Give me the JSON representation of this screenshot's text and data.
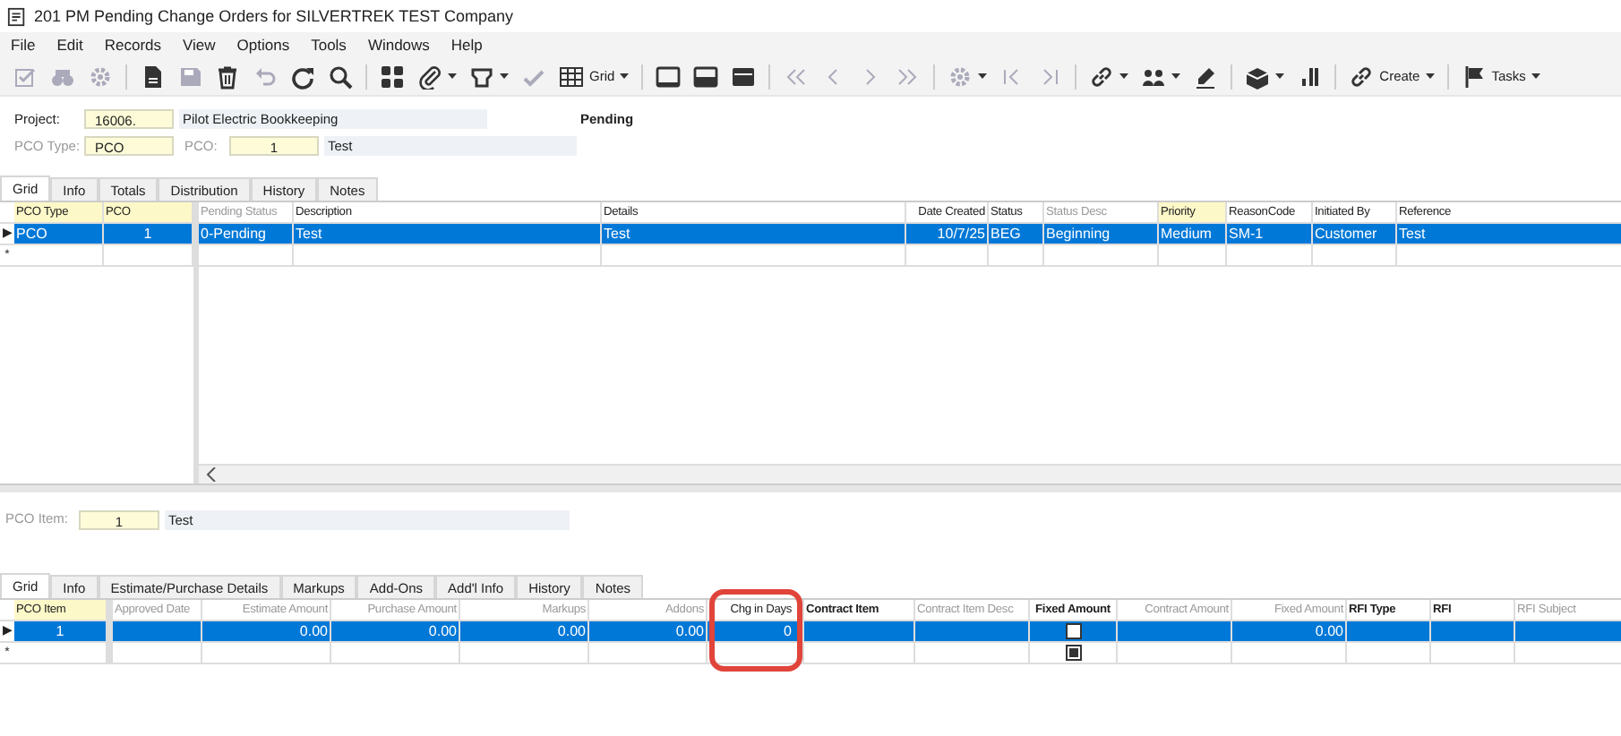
{
  "window": {
    "title": "201 PM Pending Change Orders for SILVERTREK TEST Company"
  },
  "menu": [
    "File",
    "Edit",
    "Records",
    "View",
    "Options",
    "Tools",
    "Windows",
    "Help"
  ],
  "toolbar": [
    {
      "disabled": true,
      "dropdown": false
    },
    {
      "disabled": true,
      "dropdown": false
    },
    {
      "disabled": true,
      "dropdown": false
    },
    {
      "disabled": false,
      "dropdown": false
    },
    {
      "disabled": true,
      "dropdown": false
    },
    {
      "disabled": false,
      "dropdown": false
    },
    {
      "disabled": true,
      "dropdown": false
    },
    {
      "disabled": false,
      "dropdown": false
    },
    {
      "disabled": false,
      "dropdown": false
    },
    {
      "disabled": false,
      "dropdown": false
    },
    {
      "disabled": false,
      "dropdown": true
    },
    {
      "disabled": false,
      "dropdown": true
    },
    {
      "disabled": true,
      "dropdown": false
    },
    {
      "disabled": false,
      "dropdown": true,
      "label": "Grid"
    },
    {
      "disabled": false,
      "dropdown": false
    },
    {
      "disabled": false,
      "dropdown": false
    },
    {
      "disabled": false,
      "dropdown": false
    },
    {
      "disabled": true,
      "dropdown": false
    },
    {
      "disabled": true,
      "dropdown": false
    },
    {
      "disabled": true,
      "dropdown": false
    },
    {
      "disabled": true,
      "dropdown": false
    },
    {
      "disabled": true,
      "dropdown": true
    },
    {
      "disabled": true,
      "dropdown": false
    },
    {
      "disabled": true,
      "dropdown": false
    },
    {
      "disabled": false,
      "dropdown": true
    },
    {
      "disabled": false,
      "dropdown": true
    },
    {
      "disabled": false,
      "dropdown": false
    },
    {
      "disabled": false,
      "dropdown": true
    },
    {
      "disabled": false,
      "dropdown": false
    },
    {
      "disabled": false,
      "dropdown": true,
      "label": "Create"
    },
    {
      "disabled": false,
      "dropdown": true,
      "label": "Tasks"
    }
  ],
  "header": {
    "project": {
      "label": "Project:",
      "value": "16006.",
      "description": "Pilot Electric Bookkeeping",
      "disabled": false
    },
    "status": "Pending",
    "pco_type": {
      "label": "PCO Type:",
      "value": "PCO",
      "disabled": true
    },
    "pco": {
      "label": "PCO:",
      "value": "1",
      "description": "Test",
      "disabled": true
    }
  },
  "tabs": [
    {
      "label": "Grid",
      "selected": true
    },
    {
      "label": "Info",
      "selected": false
    },
    {
      "label": "Totals",
      "selected": false
    },
    {
      "label": "Distribution",
      "selected": false
    },
    {
      "label": "History",
      "selected": false
    },
    {
      "label": "Notes",
      "selected": false
    }
  ],
  "pco_grid": {
    "columns": [
      {
        "label": "PCO Type",
        "highlighted": true
      },
      {
        "label": "PCO",
        "highlighted": true
      }
    ],
    "rows": [
      {
        "indicator": "▶",
        "selected": true,
        "cells": [
          "PCO",
          "1"
        ]
      },
      {
        "indicator": "*",
        "selected": false,
        "cells": [
          null,
          null
        ]
      }
    ]
  },
  "details_grid": {
    "columns": [
      {
        "label": "Pending Status",
        "muted": true,
        "highlighted": false
      },
      {
        "label": "Description",
        "muted": false,
        "highlighted": false
      },
      {
        "label": "Details",
        "muted": false,
        "highlighted": false
      },
      {
        "label": "Date Created",
        "muted": false,
        "highlighted": false
      },
      {
        "label": "Status",
        "muted": false,
        "highlighted": false
      },
      {
        "label": "Status Desc",
        "muted": true,
        "highlighted": false
      },
      {
        "label": "Priority",
        "muted": false,
        "highlighted": true
      },
      {
        "label": "ReasonCode",
        "muted": false,
        "highlighted": false
      },
      {
        "label": "Initiated By",
        "muted": false,
        "highlighted": false
      },
      {
        "label": "Reference",
        "muted": false,
        "highlighted": false
      }
    ],
    "rows": [
      {
        "selected": true,
        "cells": [
          "0-Pending",
          "Test",
          "Test",
          "10/7/25",
          "BEG",
          "Beginning",
          "Medium",
          "SM-1",
          "Customer",
          "Test"
        ]
      },
      {
        "selected": false,
        "cells": [
          null,
          null,
          null,
          null,
          null,
          null,
          null,
          null,
          null,
          null
        ]
      }
    ]
  },
  "item": {
    "label": "PCO Item:",
    "value": "1",
    "description": "Test",
    "disabled": true
  },
  "item_tabs": [
    {
      "label": "Grid",
      "selected": true
    },
    {
      "label": "Info",
      "selected": false
    },
    {
      "label": "Estimate/Purchase Details",
      "selected": false
    },
    {
      "label": "Markups",
      "selected": false
    },
    {
      "label": "Add-Ons",
      "selected": false
    },
    {
      "label": "Add'l Info",
      "selected": false
    },
    {
      "label": "History",
      "selected": false
    },
    {
      "label": "Notes",
      "selected": false
    }
  ],
  "item_key_grid": {
    "columns": [
      {
        "label": "PCO Item",
        "highlighted": true
      }
    ],
    "rows": [
      {
        "indicator": "▶",
        "selected": true,
        "cells": [
          "1"
        ]
      },
      {
        "indicator": "*",
        "selected": false,
        "cells": [
          null
        ]
      }
    ]
  },
  "item_grid": {
    "columns": [
      {
        "label": "Approved Date",
        "muted": true,
        "bold": false
      },
      {
        "label": "Estimate Amount",
        "muted": true,
        "bold": false
      },
      {
        "label": "Purchase Amount",
        "muted": true,
        "bold": false
      },
      {
        "label": "Markups",
        "muted": true,
        "bold": false
      },
      {
        "label": "Addons",
        "muted": true,
        "bold": false
      },
      {
        "label": "Chg in Days",
        "muted": false,
        "bold": false
      },
      {
        "label": "Contract Item",
        "muted": false,
        "bold": true
      },
      {
        "label": "Contract Item Desc",
        "muted": true,
        "bold": false
      },
      {
        "label": "Fixed Amount",
        "muted": false,
        "bold": true
      },
      {
        "label": "Contract Amount",
        "muted": true,
        "bold": false
      },
      {
        "label": "Fixed Amount",
        "muted": true,
        "bold": false
      },
      {
        "label": "RFI Type",
        "muted": false,
        "bold": true
      },
      {
        "label": "RFI",
        "muted": false,
        "bold": true
      },
      {
        "label": "RFI Subject",
        "muted": true,
        "bold": false
      }
    ],
    "rows": [
      {
        "selected": true,
        "cells": [
          null,
          "0.00",
          "0.00",
          "0.00",
          "0.00",
          "0",
          null,
          null,
          {
            "kind": "checkbox",
            "indeterminate": false
          },
          null,
          "0.00",
          null,
          null,
          null
        ]
      },
      {
        "selected": false,
        "cells": [
          null,
          null,
          null,
          null,
          null,
          null,
          null,
          null,
          {
            "kind": "checkbox",
            "indeterminate": true
          },
          null,
          null,
          null,
          null,
          null
        ]
      }
    ]
  },
  "annotation": {
    "kind": "ring"
  }
}
